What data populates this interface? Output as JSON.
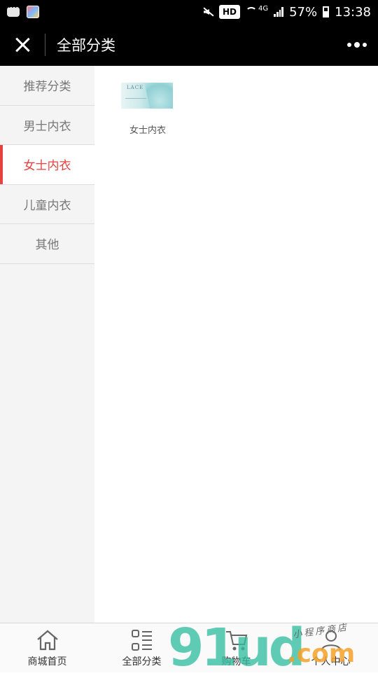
{
  "status_bar": {
    "hd": "HD",
    "network": "4G",
    "battery": "57%",
    "time": "13:38"
  },
  "header": {
    "title": "全部分类"
  },
  "sidebar": {
    "items": [
      {
        "label": "推荐分类",
        "active": false
      },
      {
        "label": "男士内衣",
        "active": false
      },
      {
        "label": "女士内衣",
        "active": true
      },
      {
        "label": "儿童内衣",
        "active": false
      },
      {
        "label": "其他",
        "active": false
      }
    ]
  },
  "content": {
    "products": [
      {
        "name": "女士内衣",
        "thumb_text": "LACE"
      }
    ]
  },
  "tab_bar": {
    "items": [
      {
        "label": "商城首页",
        "icon": "home-icon"
      },
      {
        "label": "全部分类",
        "icon": "category-icon"
      },
      {
        "label": "购物车",
        "icon": "cart-icon"
      },
      {
        "label": "个人中心",
        "icon": "user-icon"
      }
    ]
  },
  "watermark": {
    "main": "91ud",
    "suffix": ".com",
    "caption": "小程序商店"
  },
  "colors": {
    "accent": "#e64340",
    "header_bg": "#000000",
    "sidebar_bg": "#f4f4f4"
  }
}
